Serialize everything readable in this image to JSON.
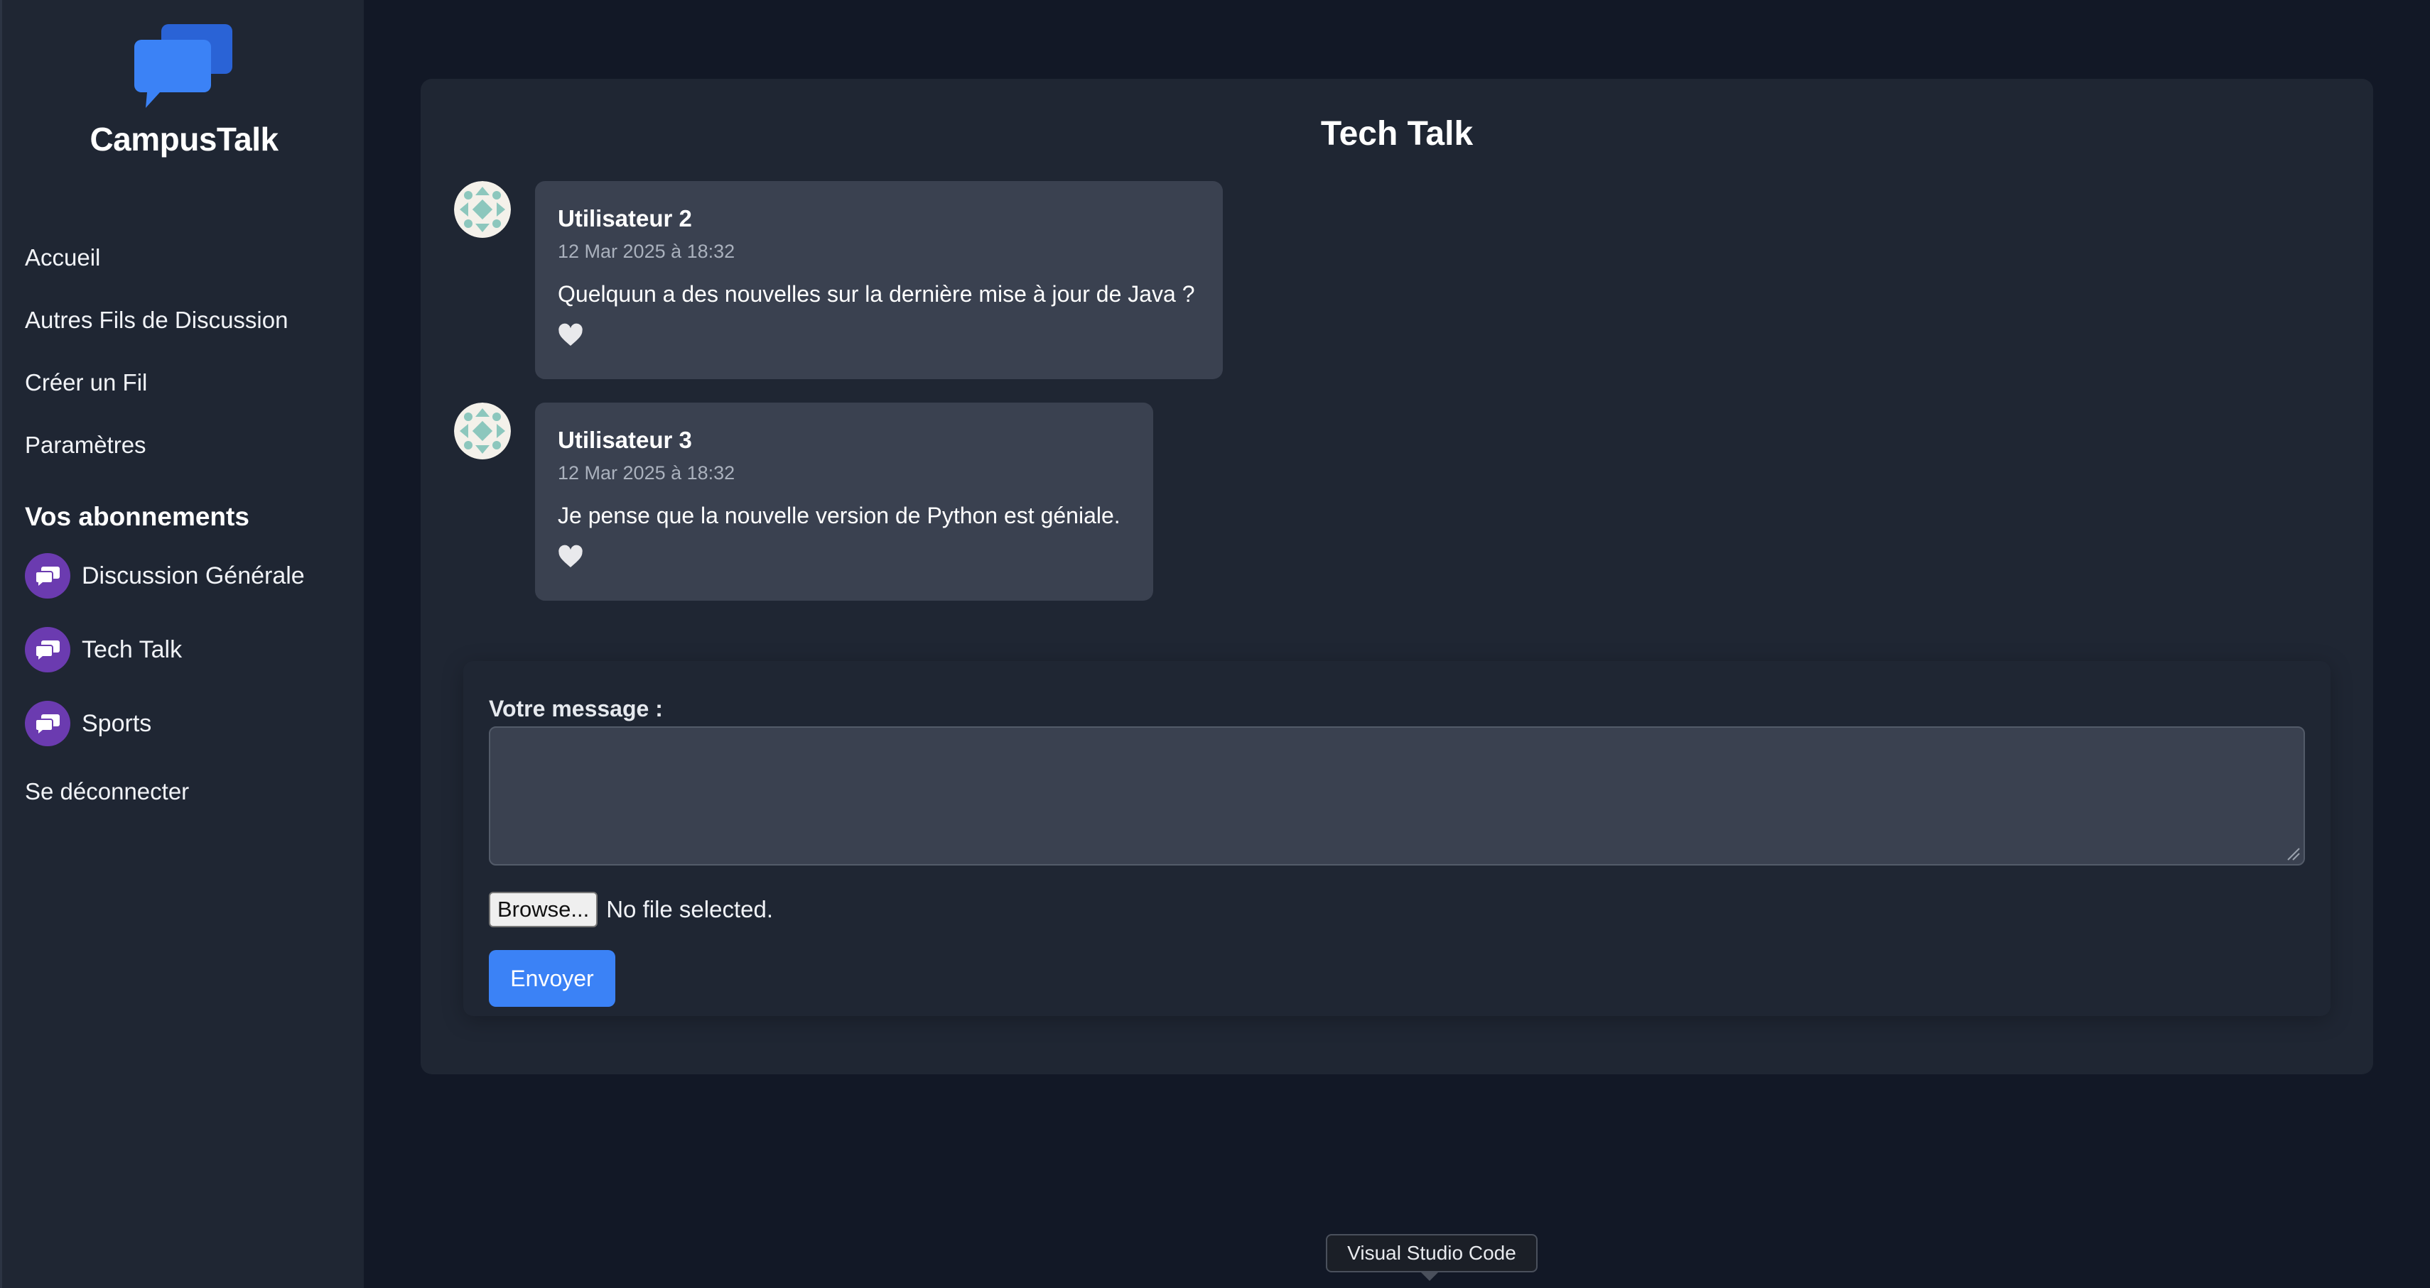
{
  "app": {
    "brand_name": "CampusTalk",
    "logo_icon": "chat-bubbles-icon"
  },
  "sidebar": {
    "nav": [
      {
        "label": "Accueil"
      },
      {
        "label": "Autres Fils de Discussion"
      },
      {
        "label": "Créer un Fil"
      },
      {
        "label": "Paramètres"
      }
    ],
    "subscriptions_title": "Vos abonnements",
    "subscriptions": [
      {
        "label": "Discussion Générale",
        "icon": "chat-icon"
      },
      {
        "label": "Tech Talk",
        "icon": "chat-icon"
      },
      {
        "label": "Sports",
        "icon": "chat-icon"
      }
    ],
    "logout_label": "Se déconnecter"
  },
  "thread": {
    "title": "Tech Talk",
    "messages": [
      {
        "author": "Utilisateur 2",
        "date": "12 Mar 2025 à 18:32",
        "text": "Quelquun a des nouvelles sur la dernière mise à jour de Java ?",
        "like_icon": "heart-icon"
      },
      {
        "author": "Utilisateur 3",
        "date": "12 Mar 2025 à 18:32",
        "text": "Je pense que la nouvelle version de Python est géniale.",
        "like_icon": "heart-icon"
      }
    ]
  },
  "composer": {
    "label": "Votre message :",
    "message_value": "",
    "browse_label": "Browse...",
    "file_status": "No file selected.",
    "send_label": "Envoyer"
  },
  "tooltip": {
    "text": "Visual Studio Code"
  },
  "colors": {
    "background": "#121826",
    "panel": "#1f2633",
    "card": "#3a4150",
    "accent": "#3b82f6",
    "subscription_badge": "#6b3bb0"
  }
}
